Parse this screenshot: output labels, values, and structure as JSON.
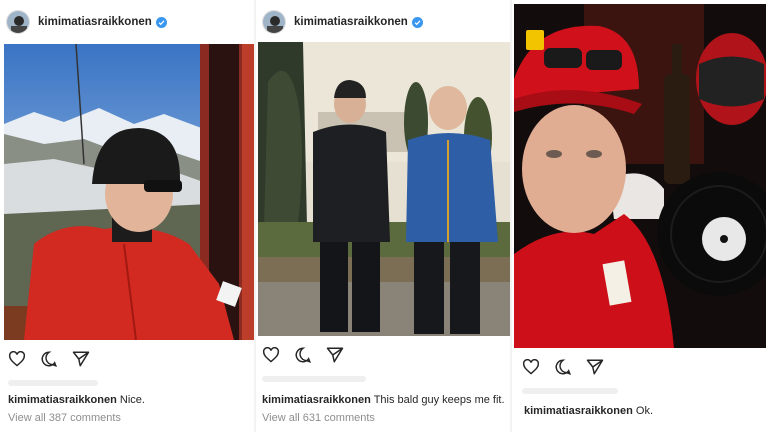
{
  "posts": [
    {
      "username": "kimimatiasraikkonen",
      "caption": "Nice.",
      "comments_link": "View all 387 comments"
    },
    {
      "username": "kimimatiasraikkonen",
      "caption": "This bald guy keeps me fit.",
      "comments_link": "View all 631 comments"
    },
    {
      "username": "kimimatiasraikkonen",
      "caption": "Ok."
    }
  ],
  "icons": [
    "verified-badge-icon",
    "heart-icon",
    "comment-icon",
    "share-icon"
  ],
  "colors": {
    "verified": "#3897f0",
    "text": "#262626",
    "muted": "#8e8e8e",
    "ferrari_red": "#d0101a"
  }
}
